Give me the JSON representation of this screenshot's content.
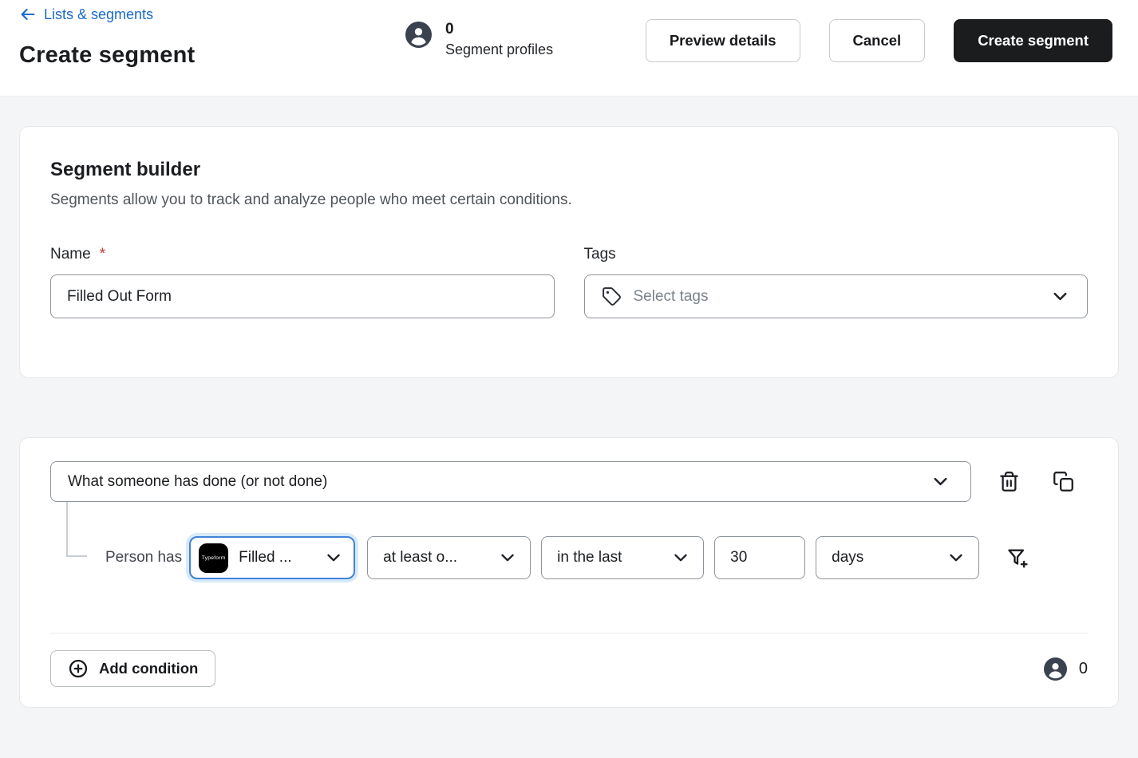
{
  "header": {
    "back_link": "Lists & segments",
    "title": "Create segment",
    "profiles": {
      "count": "0",
      "label": "Segment profiles"
    },
    "buttons": {
      "preview": "Preview details",
      "cancel": "Cancel",
      "create": "Create segment"
    }
  },
  "builder": {
    "title": "Segment builder",
    "description": "Segments allow you to track and analyze people who meet certain conditions.",
    "name_label": "Name",
    "required_mark": "*",
    "name_value": "Filled Out Form",
    "tags_label": "Tags",
    "tags_placeholder": "Select tags"
  },
  "condition": {
    "type_value": "What someone has done (or not done)",
    "person_has": "Person has",
    "action_icon_text": "Typeform",
    "action_value": "Filled ...",
    "frequency_value": "at least o...",
    "timeframe_value": "in the last",
    "amount_value": "30",
    "unit_value": "days",
    "add_button": "Add condition",
    "count": "0"
  },
  "colors": {
    "link_blue": "#1b6ac9",
    "primary_button": "#1b1c1e",
    "focus_border": "#4083d9",
    "focus_glow": "#d7eafa",
    "page_background": "#f4f5f7",
    "avatar_fill": "#3a414f",
    "required_red": "#cf3327"
  }
}
